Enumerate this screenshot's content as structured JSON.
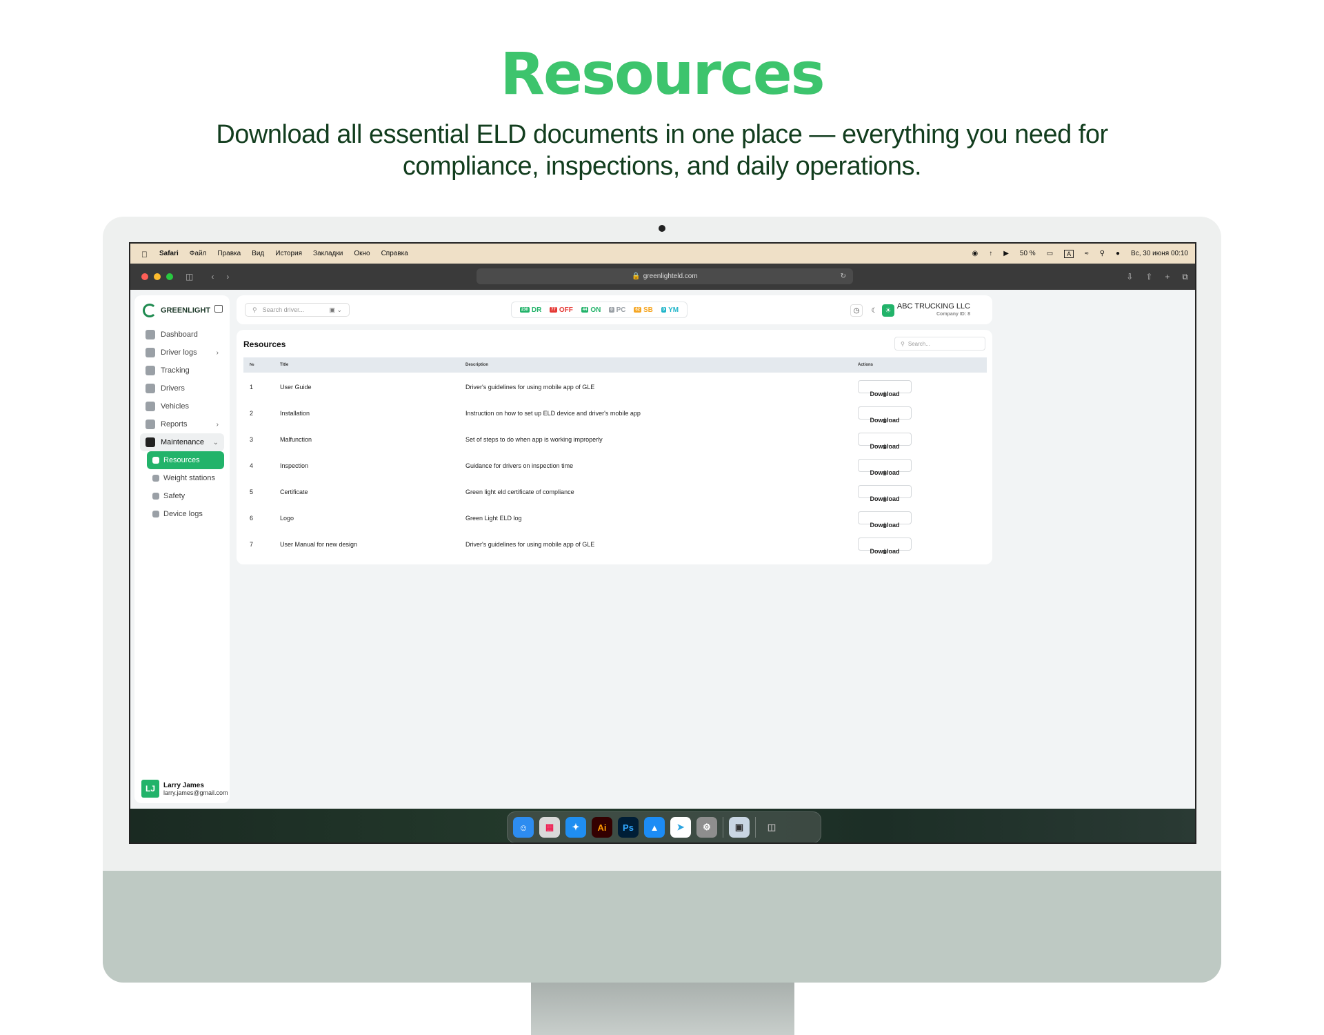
{
  "hero": {
    "title": "Resources",
    "subtitle": "Download all essential ELD documents in one place — everything you need for compliance, inspections, and daily operations."
  },
  "menubar": {
    "items": [
      "Safari",
      "Файл",
      "Правка",
      "Вид",
      "История",
      "Закладки",
      "Окно",
      "Справка"
    ],
    "battery": "50 %",
    "input_source": "A",
    "datetime": "Вс, 30 июня 00:10"
  },
  "browser": {
    "url": "greenlighteld.com"
  },
  "sidebar": {
    "brand": "GREENLIGHT",
    "items": [
      {
        "label": "Dashboard",
        "icon": "dashboard-icon"
      },
      {
        "label": "Driver logs",
        "icon": "driver-logs-icon"
      },
      {
        "label": "Tracking",
        "icon": "map-icon"
      },
      {
        "label": "Drivers",
        "icon": "driver-icon"
      },
      {
        "label": "Vehicles",
        "icon": "truck-icon"
      },
      {
        "label": "Reports",
        "icon": "reports-icon"
      },
      {
        "label": "Maintenance",
        "icon": "layers-icon"
      }
    ],
    "subitems": [
      {
        "label": "Resources",
        "icon": "layers-icon"
      },
      {
        "label": "Weight stations",
        "icon": "scale-icon"
      },
      {
        "label": "Safety",
        "icon": "shield-icon"
      },
      {
        "label": "Device logs",
        "icon": "device-icon"
      }
    ],
    "user": {
      "initials": "LJ",
      "name": "Larry James",
      "email": "larry.james@gmail.com"
    }
  },
  "topbar": {
    "search_placeholder": "Search driver...",
    "statuses": [
      {
        "count": "230",
        "label": "DR",
        "color": "#22b36a"
      },
      {
        "count": "77",
        "label": "OFF",
        "color": "#e53935"
      },
      {
        "count": "44",
        "label": "ON",
        "color": "#22b36a"
      },
      {
        "count": "0",
        "label": "PC",
        "color": "#9aa0a6"
      },
      {
        "count": "62",
        "label": "SB",
        "color": "#f5a623"
      },
      {
        "count": "0",
        "label": "YM",
        "color": "#20b5c9"
      }
    ],
    "company_name": "ABC TRUCKING LLC",
    "company_id": "Company ID: 8"
  },
  "resources": {
    "title": "Resources",
    "search_placeholder": "Search...",
    "columns": {
      "num": "№",
      "title": "Title",
      "description": "Description",
      "actions": "Actions"
    },
    "download_label": "Download",
    "rows": [
      {
        "num": "1",
        "title": "User Guide",
        "description": "Driver's guidelines for using mobile app of GLE"
      },
      {
        "num": "2",
        "title": "Installation",
        "description": "Instruction on how to set up ELD device and driver's mobile app"
      },
      {
        "num": "3",
        "title": "Malfunction",
        "description": "Set of steps to do when app is working improperly"
      },
      {
        "num": "4",
        "title": "Inspection",
        "description": "Guidance for drivers on inspection time"
      },
      {
        "num": "5",
        "title": "Certificate",
        "description": "Green light eld certificate of compliance"
      },
      {
        "num": "6",
        "title": "Logo",
        "description": "Green Light ELD log"
      },
      {
        "num": "7",
        "title": "User Manual for new design",
        "description": "Driver's guidelines for using mobile app of GLE"
      }
    ]
  },
  "dock": {
    "apps": [
      {
        "name": "finder-icon",
        "label": "",
        "color": "#2d8cf0"
      },
      {
        "name": "launchpad-icon",
        "label": "",
        "color": "#d9d9d9"
      },
      {
        "name": "safari-icon",
        "label": "",
        "color": "#1f8ef1"
      },
      {
        "name": "illustrator-icon",
        "label": "Ai",
        "color": "#330000"
      },
      {
        "name": "photoshop-icon",
        "label": "Ps",
        "color": "#001e36"
      },
      {
        "name": "app-store-icon",
        "label": "",
        "color": "#1c8cf5"
      },
      {
        "name": "telegram-icon",
        "label": "",
        "color": "#ffffff"
      },
      {
        "name": "system-settings-icon",
        "label": "",
        "color": "#8e8e8e"
      },
      {
        "name": "preview-icon",
        "label": "",
        "color": "#c9d6e3"
      },
      {
        "name": "trash-icon",
        "label": "",
        "color": "#7a7a7a"
      }
    ]
  }
}
